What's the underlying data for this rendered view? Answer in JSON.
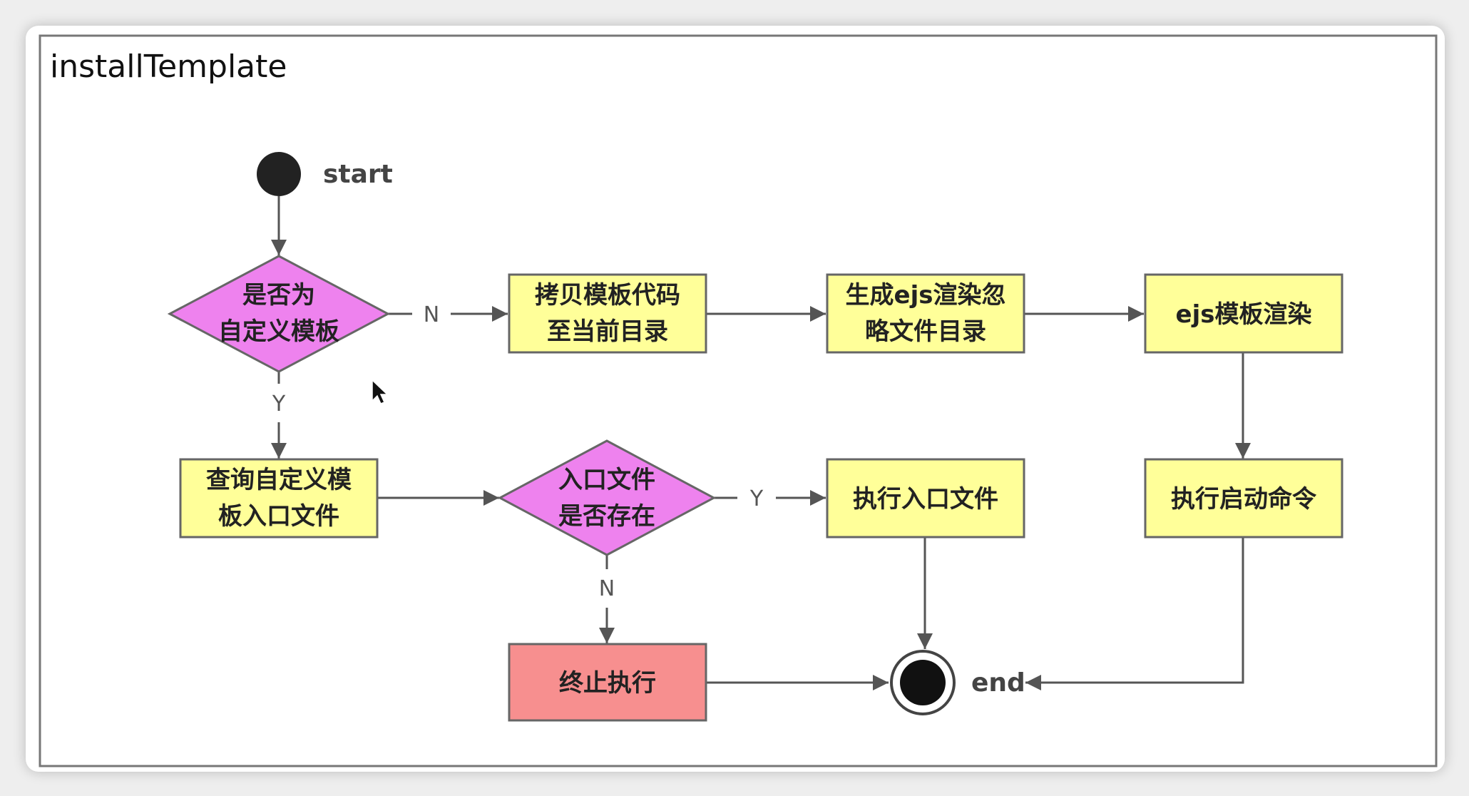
{
  "diagram": {
    "title": "installTemplate",
    "colors": {
      "process": "#ffff99",
      "decision": "#ee82ee",
      "terminate": "#f78f8f",
      "stroke": "#666666",
      "edge": "#555555"
    },
    "nodes": {
      "start": {
        "label": "start"
      },
      "is_custom": {
        "line1": "是否为",
        "line2": "自定义模板"
      },
      "copy_code": {
        "line1": "拷贝模板代码",
        "line2": "至当前目录"
      },
      "gen_ignore": {
        "line1": "生成ejs渲染忽",
        "line2": "略文件目录"
      },
      "ejs_render": {
        "line1": "ejs模板渲染"
      },
      "query_entry": {
        "line1": "查询自定义模",
        "line2": "板入口文件"
      },
      "entry_exists": {
        "line1": "入口文件",
        "line2": "是否存在"
      },
      "exec_entry": {
        "line1": "执行入口文件"
      },
      "exec_start": {
        "line1": "执行启动命令"
      },
      "terminate": {
        "line1": "终止执行"
      },
      "end": {
        "label": "end"
      }
    },
    "edge_labels": {
      "custom_no": "N",
      "custom_yes": "Y",
      "exists_yes": "Y",
      "exists_no": "N"
    }
  }
}
